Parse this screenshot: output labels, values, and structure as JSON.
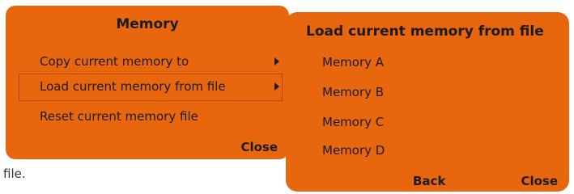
{
  "menu": {
    "title": "Memory",
    "items": [
      {
        "label": "Copy current memory to",
        "has_submenu": true,
        "selected": false
      },
      {
        "label": "Load current memory from file",
        "has_submenu": true,
        "selected": true
      },
      {
        "label": "Reset current memory file",
        "has_submenu": false,
        "selected": false
      }
    ],
    "close_label": "Close"
  },
  "submenu": {
    "title": "Load current memory from file",
    "items": [
      "Memory A",
      "Memory B",
      "Memory C",
      "Memory D"
    ],
    "back_label": "Back",
    "close_label": "Close"
  },
  "background_text": "file.",
  "colors": {
    "panel": "#e8670e",
    "text": "#1c1c1c",
    "selected_border": "#b24a00"
  }
}
